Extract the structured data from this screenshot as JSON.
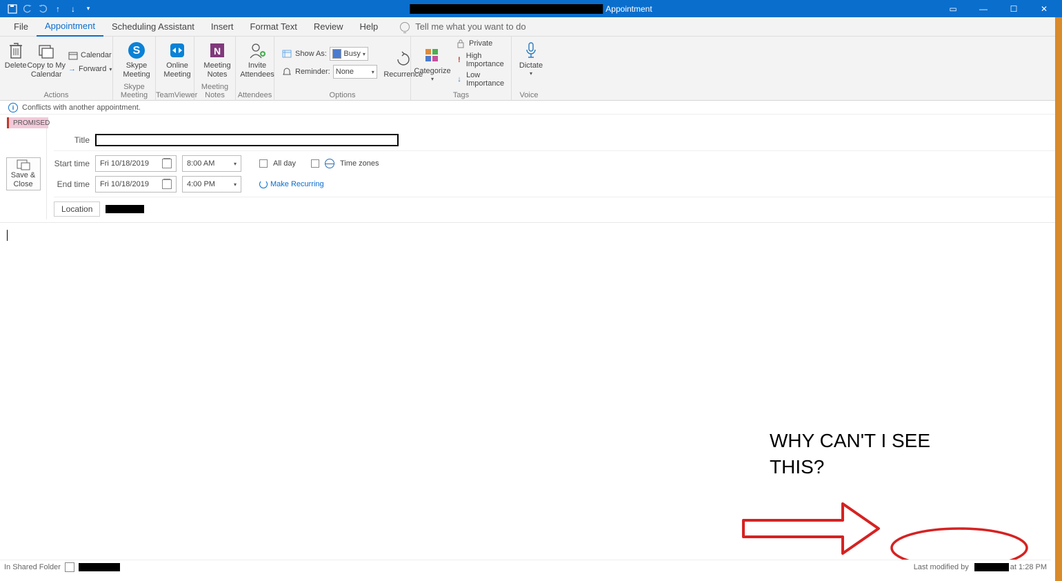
{
  "titlebar": {
    "app_label": "Appointment",
    "window_tab_button": "▭",
    "min": "—",
    "max": "☐",
    "close": "✕"
  },
  "menu": {
    "file": "File",
    "appointment": "Appointment",
    "scheduling": "Scheduling Assistant",
    "insert": "Insert",
    "format": "Format Text",
    "review": "Review",
    "help": "Help",
    "tellme": "Tell me what you want to do"
  },
  "ribbon": {
    "actions": {
      "delete": "Delete",
      "copy_to_my_calendar": "Copy to My\nCalendar",
      "calendar": "Calendar",
      "forward": "Forward",
      "label": "Actions"
    },
    "skype": {
      "line1": "Skype",
      "line2": "Meeting",
      "label": "Skype Meeting"
    },
    "teamviewer": {
      "line1": "Online",
      "line2": "Meeting",
      "label": "TeamViewer"
    },
    "meetingnotes": {
      "line1": "Meeting",
      "line2": "Notes",
      "label": "Meeting Notes"
    },
    "attendees": {
      "line1": "Invite",
      "line2": "Attendees",
      "label": "Attendees"
    },
    "options": {
      "showas_label": "Show As:",
      "showas_value": "Busy",
      "reminder_label": "Reminder:",
      "reminder_value": "None",
      "recurrence": "Recurrence",
      "label": "Options"
    },
    "tags": {
      "categorize": "Categorize",
      "private": "Private",
      "high": "High Importance",
      "low": "Low Importance",
      "label": "Tags"
    },
    "voice": {
      "dictate": "Dictate",
      "label": "Voice"
    }
  },
  "infobar": {
    "text": "Conflicts with another appointment."
  },
  "promised_tag": "PROMISED",
  "form": {
    "saveclose_line1": "Save &",
    "saveclose_line2": "Close",
    "title_label": "Title",
    "start_label": "Start time",
    "start_date": "Fri 10/18/2019",
    "start_time": "8:00 AM",
    "end_label": "End time",
    "end_date": "Fri 10/18/2019",
    "end_time": "4:00 PM",
    "allday": "All day",
    "timezones": "Time zones",
    "make_recurring": "Make Recurring",
    "location_label": "Location"
  },
  "annotation": {
    "line1": "WHY CAN'T I SEE",
    "line2": "THIS?"
  },
  "statusbar": {
    "left": "In Shared Folder",
    "right_prefix": "Last modified by",
    "right_suffix": "at 1:28 PM"
  }
}
